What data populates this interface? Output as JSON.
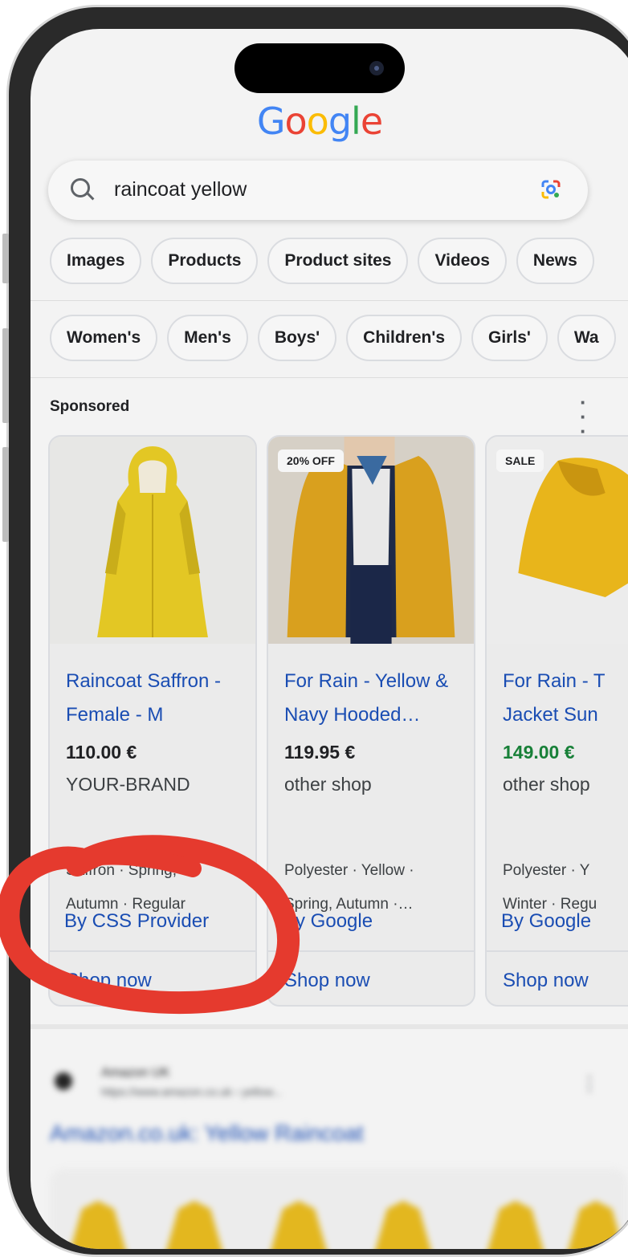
{
  "logo": {
    "letters": [
      "G",
      "o",
      "o",
      "g",
      "l",
      "e"
    ],
    "colors": [
      "#4285F4",
      "#EA4335",
      "#FBBC05",
      "#4285F4",
      "#34A853",
      "#EA4335"
    ]
  },
  "search": {
    "query": "raincoat yellow",
    "icon": "search-icon",
    "lens_icon": "google-lens-icon"
  },
  "chips": [
    "Images",
    "Products",
    "Product sites",
    "Videos",
    "News"
  ],
  "filters": [
    "Women's",
    "Men's",
    "Boys'",
    "Children's",
    "Girls'",
    "Wa"
  ],
  "sponsored": {
    "label": "Sponsored",
    "menu_icon": "more-vert-icon"
  },
  "products": [
    {
      "badge": "",
      "title": "Raincoat Saffron - Female - M",
      "price": "110.00 €",
      "price_color": "#202124",
      "shop": "YOUR-BRAND",
      "attributes": [
        "Saffron · Spring,",
        "Autumn · Regular"
      ],
      "by": "By CSS Provider",
      "cta": "Shop now"
    },
    {
      "badge": "20% OFF",
      "title": "For Rain - Yellow & Navy Hooded…",
      "price": "119.95 €",
      "price_color": "#202124",
      "shop": "other shop",
      "attributes": [
        "Polyester · Yellow ·",
        "Spring, Autumn ·…"
      ],
      "by": "By Google",
      "cta": "Shop now"
    },
    {
      "badge": "SALE",
      "title": "For Rain - T Jacket Sun",
      "price": "149.00 €",
      "price_color": "#188038",
      "shop": "other shop",
      "attributes": [
        "Polyester · Y",
        "Winter · Regu"
      ],
      "by": "By Google",
      "cta": "Shop now"
    }
  ],
  "organic_result": {
    "site": "Amazon UK",
    "url": "https://www.amazon.co.uk › yellow...",
    "title": "Amazon.co.uk: Yellow Raincoat"
  },
  "annotation": {
    "color": "#e53a2e",
    "type": "hand-drawn-circle"
  }
}
